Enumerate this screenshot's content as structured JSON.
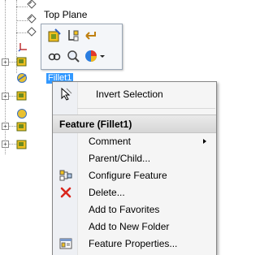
{
  "tree": {
    "top_plane_label": "Top Plane",
    "selected_feature_label": "Fillet1",
    "icons": [
      "plane-icon",
      "origin-icon",
      "feature-icon",
      "fillet-icon"
    ]
  },
  "context_toolbar": {
    "buttons": [
      {
        "name": "edit-feature-icon"
      },
      {
        "name": "edit-sketch-icon"
      },
      {
        "name": "rollback-icon"
      },
      {
        "name": "hide-show-icon"
      },
      {
        "name": "zoom-to-selection-icon"
      },
      {
        "name": "appearance-icon"
      }
    ]
  },
  "context_menu": {
    "invert_selection": "Invert Selection",
    "section_title": "Feature (Fillet1)",
    "items": [
      {
        "label": "Comment"
      },
      {
        "label": "Parent/Child..."
      },
      {
        "label": "Configure Feature"
      },
      {
        "label": "Delete..."
      },
      {
        "label": "Add to Favorites"
      },
      {
        "label": "Add to New Folder"
      },
      {
        "label": "Feature Properties..."
      }
    ]
  },
  "colors": {
    "selection": "#3399ff",
    "delete_red": "#d9261c"
  }
}
